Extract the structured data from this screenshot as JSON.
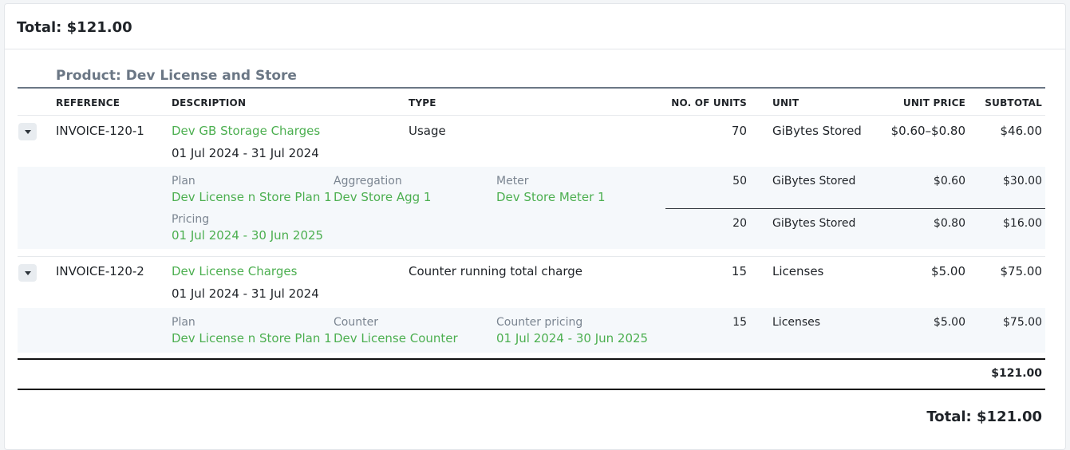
{
  "header": {
    "title": "Total: $121.00"
  },
  "product": {
    "label": "Product: Dev License and Store"
  },
  "columns": {
    "reference": "REFERENCE",
    "description": "DESCRIPTION",
    "type": "TYPE",
    "units": "NO. OF UNITS",
    "unit": "UNIT",
    "unit_price": "UNIT PRICE",
    "subtotal": "SUBTOTAL"
  },
  "rows": [
    {
      "reference": "INVOICE-120-1",
      "description": "Dev GB Storage Charges",
      "period": "01 Jul 2024 - 31 Jul 2024",
      "type": "Usage",
      "units": "70",
      "unit": "GiBytes Stored",
      "unit_price": "$0.60–$0.80",
      "subtotal": "$46.00",
      "details": {
        "plan_label": "Plan",
        "plan": "Dev License n Store Plan 1",
        "aggregation_label": "Aggregation",
        "aggregation": "Dev Store Agg 1",
        "meter_label": "Meter",
        "meter": "Dev Store Meter 1",
        "pricing_label": "Pricing",
        "pricing": "01 Jul 2024 - 30 Jun 2025",
        "tiers": [
          {
            "units": "50",
            "unit": "GiBytes Stored",
            "unit_price": "$0.60",
            "subtotal": "$30.00"
          },
          {
            "units": "20",
            "unit": "GiBytes Stored",
            "unit_price": "$0.80",
            "subtotal": "$16.00"
          }
        ]
      }
    },
    {
      "reference": "INVOICE-120-2",
      "description": "Dev License Charges",
      "period": "01 Jul 2024 - 31 Jul 2024",
      "type": "Counter running total charge",
      "units": "15",
      "unit": "Licenses",
      "unit_price": "$5.00",
      "subtotal": "$75.00",
      "details": {
        "plan_label": "Plan",
        "plan": "Dev License n Store Plan 1",
        "counter_label": "Counter",
        "counter": "Dev License Counter",
        "counter_pricing_label": "Counter pricing",
        "counter_pricing": "01 Jul 2024 - 30 Jun 2025",
        "tiers": [
          {
            "units": "15",
            "unit": "Licenses",
            "unit_price": "$5.00",
            "subtotal": "$75.00"
          }
        ]
      }
    }
  ],
  "summary": {
    "product_total": "$121.00",
    "grand_total": "Total: $121.00"
  },
  "colors": {
    "accent": "#4caf50",
    "muted": "#6b7785",
    "detail_bg": "#f5f8fb"
  }
}
